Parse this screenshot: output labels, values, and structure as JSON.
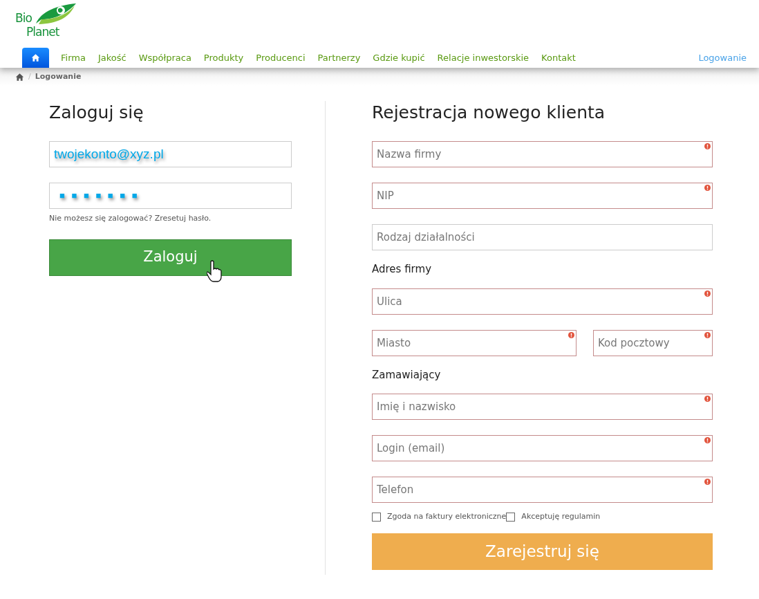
{
  "logo": {
    "line_1": "Bio",
    "line_2": "Planet"
  },
  "nav": {
    "items": [
      {
        "label": "Firma",
        "selected": false
      },
      {
        "label": "Jakość",
        "selected": false
      },
      {
        "label": "Współpraca",
        "selected": false
      },
      {
        "label": "Produkty",
        "selected": false
      },
      {
        "label": "Producenci",
        "selected": false
      },
      {
        "label": "Partnerzy",
        "selected": false
      },
      {
        "label": "Gdzie kupić",
        "selected": false
      },
      {
        "label": "Relacje inwestorskie",
        "selected": false
      },
      {
        "label": "Kontakt",
        "selected": false
      }
    ],
    "login_link": "Logowanie"
  },
  "breadcrumb": {
    "separator": "/",
    "current": "Logowanie"
  },
  "login": {
    "title": "Zaloguj się",
    "email_value": "twojekonto@xyz.pl",
    "password_mask": "■ ■ ■ ■ ■ ■ ■",
    "help": "Nie możesz się zalogować? Zresetuj hasło.",
    "button": "Zaloguj"
  },
  "register": {
    "title": "Rejestracja nowego klienta",
    "rows": [
      {
        "kind": "field",
        "fields": [
          {
            "placeholder": "Nazwa firmy",
            "invalid": true
          }
        ]
      },
      {
        "kind": "field",
        "fields": [
          {
            "placeholder": "NIP",
            "invalid": true
          }
        ]
      },
      {
        "kind": "field",
        "fields": [
          {
            "placeholder": "Rodzaj działalności",
            "invalid": false
          }
        ]
      },
      {
        "kind": "heading",
        "text": "Adres firmy"
      },
      {
        "kind": "field",
        "fields": [
          {
            "placeholder": "Ulica",
            "invalid": true
          }
        ]
      },
      {
        "kind": "field",
        "fields": [
          {
            "placeholder": "Miasto",
            "invalid": true
          },
          {
            "placeholder": "Kod pocztowy",
            "invalid": true
          }
        ]
      },
      {
        "kind": "heading",
        "text": "Zamawiający"
      },
      {
        "kind": "field",
        "fields": [
          {
            "placeholder": "Imię i nazwisko",
            "invalid": true
          }
        ]
      },
      {
        "kind": "field",
        "fields": [
          {
            "placeholder": "Login (email)",
            "invalid": true
          }
        ]
      },
      {
        "kind": "field",
        "fields": [
          {
            "placeholder": "Telefon",
            "invalid": true
          }
        ]
      }
    ],
    "checkboxes": [
      {
        "label": "Zgoda na faktury elektroniczne",
        "checked": false
      },
      {
        "label": "Akceptuję regulamin",
        "checked": false
      }
    ],
    "button": "Zarejestruj się"
  }
}
